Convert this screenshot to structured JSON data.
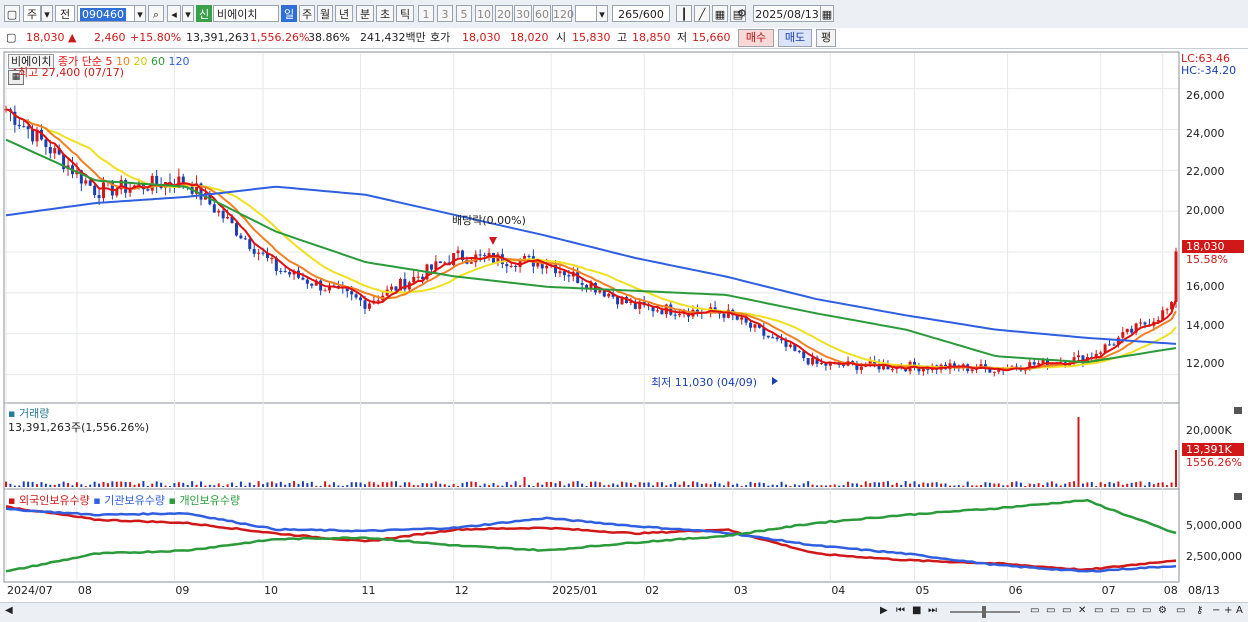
{
  "toolbar": {
    "type1": "주",
    "type2": "전",
    "code": "090460",
    "badge": "신",
    "name": "비에이치",
    "periods": [
      "일",
      "주",
      "월",
      "년",
      "분",
      "초",
      "틱"
    ],
    "active_period": "일",
    "intervals": [
      "1",
      "3",
      "5",
      "10",
      "20",
      "30",
      "60",
      "120"
    ],
    "count": "265",
    "count_max": "/600",
    "date": "2025/08/13"
  },
  "info": {
    "price": "18,030",
    "change": "2,460",
    "change_pct": "+15.80%",
    "volume": "13,391,263",
    "vol_pct": "1,556.26%",
    "turnover": "38.86%",
    "amount": "241,432백만",
    "bid_label": "호가",
    "ask": "18,030",
    "bid": "18,020",
    "open_label": "시",
    "open": "15,830",
    "high_label": "고",
    "high": "18,850",
    "low_label": "저",
    "low": "15,660",
    "buy": "매수",
    "sell": "매도",
    "eval": "평"
  },
  "price_panel": {
    "legend_name": "비에이치",
    "legend_ma": "종가 단순 5",
    "ma_periods": [
      "10",
      "20",
      "60",
      "120"
    ],
    "high_note": "최고 27,400 (07/17)",
    "low_note": "최저 11,030 (04/09)",
    "dividend_note": "배당락(0.00%)",
    "lc": "LC:63.46",
    "hc": "HC:-34.20",
    "yticks": [
      "26,000",
      "24,000",
      "22,000",
      "20,000",
      "16,000",
      "14,000",
      "12,000"
    ],
    "cur_price": "18,030",
    "cur_pct": "15.58%"
  },
  "volume_panel": {
    "title": "거래량",
    "value": "13,391,263주(1,556.26%)",
    "ytick": "20,000K",
    "cur": "13,391K",
    "cur_pct": "1556.26%"
  },
  "holding_panel": {
    "legend": [
      "외국인보유수량",
      "기관보유수량",
      "개인보유수량"
    ],
    "yticks": [
      "5,000,000",
      "2,500,000"
    ]
  },
  "x_axis": [
    "2024/07",
    "08",
    "09",
    "10",
    "11",
    "12",
    "2025/01",
    "02",
    "03",
    "04",
    "05",
    "06",
    "07",
    "08",
    "08/13"
  ],
  "colors": {
    "up": "#d01818",
    "down": "#1a3fb0",
    "ma5": "#e01010",
    "ma10": "#f08020",
    "ma20": "#f0e020",
    "ma60": "#2a9a3a",
    "ma120": "#2f5fe0",
    "foreign": "#d01818",
    "inst": "#2f5fe0",
    "indiv": "#2a9a3a"
  },
  "chart_data": {
    "type": "line",
    "title": "비에이치",
    "x": [
      "2024/07",
      "08",
      "09",
      "10",
      "11",
      "12",
      "2025/01",
      "02",
      "03",
      "04",
      "05",
      "06",
      "07",
      "08"
    ],
    "series": [
      {
        "name": "종가 단순 5",
        "values": [
          25000,
          21000,
          21500,
          17200,
          15500,
          17800,
          17500,
          15300,
          15000,
          12500,
          12400,
          12300,
          12800,
          15400
        ]
      },
      {
        "name": "60",
        "values": [
          23500,
          21500,
          21200,
          19000,
          17500,
          16800,
          16300,
          16100,
          15900,
          15000,
          14200,
          12900,
          12600,
          13300
        ]
      },
      {
        "name": "120",
        "values": [
          19800,
          20400,
          20700,
          21200,
          20800,
          19800,
          18800,
          17700,
          16800,
          15700,
          14900,
          14200,
          13800,
          13500
        ]
      }
    ],
    "ylim": [
      11000,
      27500
    ]
  }
}
